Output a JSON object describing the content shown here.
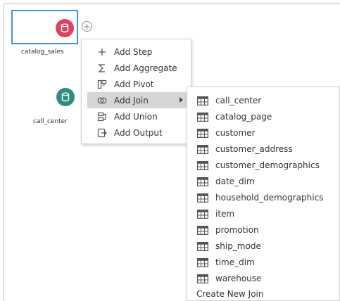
{
  "canvas": {
    "nodes": [
      {
        "name": "catalog_sales",
        "color": "#d9455f",
        "icon": "database-icon",
        "selected": true
      },
      {
        "name": "call_center",
        "color": "#2f8c7f",
        "icon": "database-icon",
        "selected": false
      }
    ],
    "add_button_icon": "plus-circle-icon"
  },
  "context_menu": {
    "items": [
      {
        "label": "Add Step",
        "icon": "plus-icon"
      },
      {
        "label": "Add Aggregate",
        "icon": "sigma-icon"
      },
      {
        "label": "Add Pivot",
        "icon": "pivot-icon"
      },
      {
        "label": "Add Join",
        "icon": "join-icon",
        "active": true,
        "has_submenu": true
      },
      {
        "label": "Add Union",
        "icon": "union-icon"
      },
      {
        "label": "Add Output",
        "icon": "output-icon"
      }
    ]
  },
  "join_submenu": {
    "tables": [
      "call_center",
      "catalog_page",
      "customer",
      "customer_address",
      "customer_demographics",
      "date_dim",
      "household_demographics",
      "item",
      "promotion",
      "ship_mode",
      "time_dim",
      "warehouse"
    ],
    "table_icon": "table-icon",
    "create_new_label": "Create New Join"
  },
  "colors": {
    "selection_border": "#4a90d9",
    "menu_highlight": "#d6d6d6"
  }
}
